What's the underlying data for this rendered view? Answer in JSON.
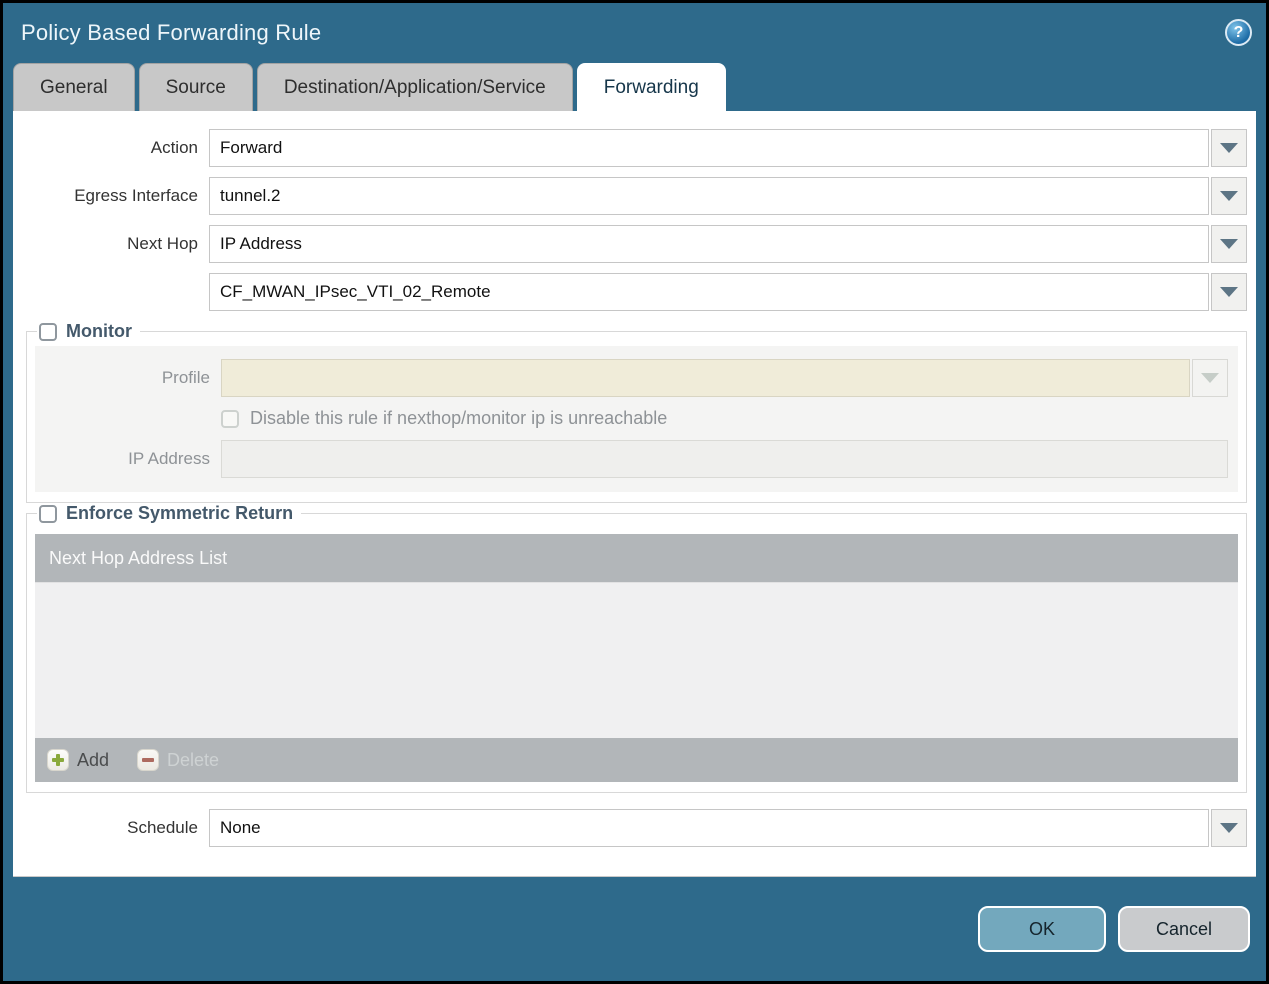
{
  "title": "Policy Based Forwarding Rule",
  "help_icon_glyph": "?",
  "tabs": [
    {
      "label": "General",
      "active": false
    },
    {
      "label": "Source",
      "active": false
    },
    {
      "label": "Destination/Application/Service",
      "active": false
    },
    {
      "label": "Forwarding",
      "active": true
    }
  ],
  "form": {
    "action_label": "Action",
    "action_value": "Forward",
    "egress_label": "Egress Interface",
    "egress_value": "tunnel.2",
    "next_hop_label": "Next Hop",
    "next_hop_value": "IP Address",
    "next_hop_address_value": "CF_MWAN_IPsec_VTI_02_Remote",
    "schedule_label": "Schedule",
    "schedule_value": "None"
  },
  "monitor": {
    "legend": "Monitor",
    "checked": false,
    "profile_label": "Profile",
    "profile_value": "",
    "disable_rule_label": "Disable this rule if nexthop/monitor ip is unreachable",
    "disable_rule_checked": false,
    "ip_address_label": "IP Address",
    "ip_address_value": ""
  },
  "symmetric_return": {
    "legend": "Enforce Symmetric Return",
    "checked": false,
    "table_header": "Next Hop Address List",
    "rows": [],
    "add_label": "Add",
    "delete_label": "Delete"
  },
  "footer": {
    "ok_label": "OK",
    "cancel_label": "Cancel"
  },
  "colors": {
    "window_background": "#2e6a8b",
    "legend_text": "#44596b",
    "table_bar": "#b2b6b9",
    "ok_button": "#73a8bd",
    "cancel_button": "#c9cbcd",
    "add_icon_green": "#8aa93c",
    "delete_icon_red": "#ad6a5f",
    "profile_disabled_bg": "#f0ecd9",
    "dropdown_arrow": "#5d7585"
  }
}
